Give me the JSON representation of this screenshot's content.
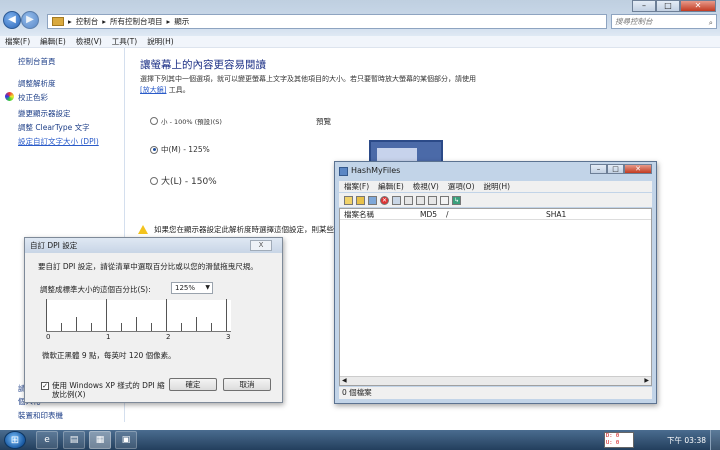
{
  "explorer": {
    "breadcrumb": [
      "控制台",
      "所有控制台項目",
      "顯示"
    ],
    "search_placeholder": "搜尋控制台",
    "menu": [
      "檔案(F)",
      "編輯(E)",
      "檢視(V)",
      "工具(T)",
      "說明(H)"
    ]
  },
  "sidebar": {
    "home": "控制台首頁",
    "items": [
      {
        "label": "調整解析度"
      },
      {
        "label": "校正色彩"
      },
      {
        "label": "變更顯示器設定"
      },
      {
        "label": "調整 ClearType 文字"
      },
      {
        "label": "設定自訂文字大小 (DPI)"
      }
    ],
    "see_also": "請",
    "bottom_items": [
      "個人化",
      "裝置和印表機"
    ]
  },
  "main": {
    "title": "讓螢幕上的內容更容易閱讀",
    "desc_line1": "選擇下列其中一個選項，就可以變更螢幕上文字及其他項目的大小。若只要暫時放大螢幕的某個部分，請使用",
    "magnifier_link": "[放大鏡]",
    "desc_tail": "工具。",
    "options": [
      {
        "label": "小 - 100% (預設)(S)",
        "selected": false
      },
      {
        "label": "中(M) - 125%",
        "selected": true
      },
      {
        "label": "大(L) - 150%",
        "selected": false
      }
    ],
    "preview_label": "預覽",
    "warning": "如果您在顯示器設定此解析度時選擇這個設定，則某些項目..."
  },
  "dpi_dialog": {
    "title": "自訂 DPI 設定",
    "close_glyph": "X",
    "instruction": "要自訂 DPI 設定，請從清單中選取百分比或以您的滑鼠拖曳尺規。",
    "scale_label": "調整成標準大小的這個百分比(S):",
    "scale_value": "125%",
    "ruler_numbers": [
      "0",
      "1",
      "2",
      "3"
    ],
    "sample_text": "微軟正黑體 9 點，每英吋 120 個像素。",
    "xp_checkbox": "使用 Windows XP 樣式的 DPI 縮放比例(X)",
    "xp_checked": true,
    "ok": "確定",
    "cancel": "取消"
  },
  "hashmyfiles": {
    "title": "HashMyFiles",
    "menu": [
      "檔案(F)",
      "編輯(E)",
      "檢視(V)",
      "選項(O)",
      "說明(H)"
    ],
    "columns": [
      "檔案名稱",
      "MD5",
      "/",
      "SHA1"
    ],
    "status": "0 個檔案"
  },
  "taskbar": {
    "clock": "下午 03:38",
    "monitor_lines": [
      "D: 0",
      "U: 0"
    ]
  },
  "colors": {
    "link": "#1e3f88",
    "title_blue": "#1e3287",
    "taskbar": "#233f5d"
  }
}
